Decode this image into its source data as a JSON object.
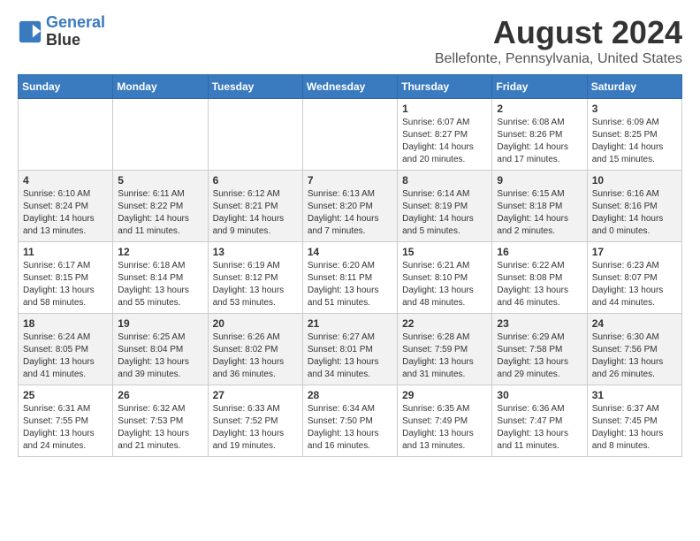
{
  "header": {
    "logo_line1": "General",
    "logo_line2": "Blue",
    "main_title": "August 2024",
    "subtitle": "Bellefonte, Pennsylvania, United States"
  },
  "days_of_week": [
    "Sunday",
    "Monday",
    "Tuesday",
    "Wednesday",
    "Thursday",
    "Friday",
    "Saturday"
  ],
  "weeks": [
    [
      {
        "day": "",
        "info": ""
      },
      {
        "day": "",
        "info": ""
      },
      {
        "day": "",
        "info": ""
      },
      {
        "day": "",
        "info": ""
      },
      {
        "day": "1",
        "info": "Sunrise: 6:07 AM\nSunset: 8:27 PM\nDaylight: 14 hours\nand 20 minutes."
      },
      {
        "day": "2",
        "info": "Sunrise: 6:08 AM\nSunset: 8:26 PM\nDaylight: 14 hours\nand 17 minutes."
      },
      {
        "day": "3",
        "info": "Sunrise: 6:09 AM\nSunset: 8:25 PM\nDaylight: 14 hours\nand 15 minutes."
      }
    ],
    [
      {
        "day": "4",
        "info": "Sunrise: 6:10 AM\nSunset: 8:24 PM\nDaylight: 14 hours\nand 13 minutes."
      },
      {
        "day": "5",
        "info": "Sunrise: 6:11 AM\nSunset: 8:22 PM\nDaylight: 14 hours\nand 11 minutes."
      },
      {
        "day": "6",
        "info": "Sunrise: 6:12 AM\nSunset: 8:21 PM\nDaylight: 14 hours\nand 9 minutes."
      },
      {
        "day": "7",
        "info": "Sunrise: 6:13 AM\nSunset: 8:20 PM\nDaylight: 14 hours\nand 7 minutes."
      },
      {
        "day": "8",
        "info": "Sunrise: 6:14 AM\nSunset: 8:19 PM\nDaylight: 14 hours\nand 5 minutes."
      },
      {
        "day": "9",
        "info": "Sunrise: 6:15 AM\nSunset: 8:18 PM\nDaylight: 14 hours\nand 2 minutes."
      },
      {
        "day": "10",
        "info": "Sunrise: 6:16 AM\nSunset: 8:16 PM\nDaylight: 14 hours\nand 0 minutes."
      }
    ],
    [
      {
        "day": "11",
        "info": "Sunrise: 6:17 AM\nSunset: 8:15 PM\nDaylight: 13 hours\nand 58 minutes."
      },
      {
        "day": "12",
        "info": "Sunrise: 6:18 AM\nSunset: 8:14 PM\nDaylight: 13 hours\nand 55 minutes."
      },
      {
        "day": "13",
        "info": "Sunrise: 6:19 AM\nSunset: 8:12 PM\nDaylight: 13 hours\nand 53 minutes."
      },
      {
        "day": "14",
        "info": "Sunrise: 6:20 AM\nSunset: 8:11 PM\nDaylight: 13 hours\nand 51 minutes."
      },
      {
        "day": "15",
        "info": "Sunrise: 6:21 AM\nSunset: 8:10 PM\nDaylight: 13 hours\nand 48 minutes."
      },
      {
        "day": "16",
        "info": "Sunrise: 6:22 AM\nSunset: 8:08 PM\nDaylight: 13 hours\nand 46 minutes."
      },
      {
        "day": "17",
        "info": "Sunrise: 6:23 AM\nSunset: 8:07 PM\nDaylight: 13 hours\nand 44 minutes."
      }
    ],
    [
      {
        "day": "18",
        "info": "Sunrise: 6:24 AM\nSunset: 8:05 PM\nDaylight: 13 hours\nand 41 minutes."
      },
      {
        "day": "19",
        "info": "Sunrise: 6:25 AM\nSunset: 8:04 PM\nDaylight: 13 hours\nand 39 minutes."
      },
      {
        "day": "20",
        "info": "Sunrise: 6:26 AM\nSunset: 8:02 PM\nDaylight: 13 hours\nand 36 minutes."
      },
      {
        "day": "21",
        "info": "Sunrise: 6:27 AM\nSunset: 8:01 PM\nDaylight: 13 hours\nand 34 minutes."
      },
      {
        "day": "22",
        "info": "Sunrise: 6:28 AM\nSunset: 7:59 PM\nDaylight: 13 hours\nand 31 minutes."
      },
      {
        "day": "23",
        "info": "Sunrise: 6:29 AM\nSunset: 7:58 PM\nDaylight: 13 hours\nand 29 minutes."
      },
      {
        "day": "24",
        "info": "Sunrise: 6:30 AM\nSunset: 7:56 PM\nDaylight: 13 hours\nand 26 minutes."
      }
    ],
    [
      {
        "day": "25",
        "info": "Sunrise: 6:31 AM\nSunset: 7:55 PM\nDaylight: 13 hours\nand 24 minutes."
      },
      {
        "day": "26",
        "info": "Sunrise: 6:32 AM\nSunset: 7:53 PM\nDaylight: 13 hours\nand 21 minutes."
      },
      {
        "day": "27",
        "info": "Sunrise: 6:33 AM\nSunset: 7:52 PM\nDaylight: 13 hours\nand 19 minutes."
      },
      {
        "day": "28",
        "info": "Sunrise: 6:34 AM\nSunset: 7:50 PM\nDaylight: 13 hours\nand 16 minutes."
      },
      {
        "day": "29",
        "info": "Sunrise: 6:35 AM\nSunset: 7:49 PM\nDaylight: 13 hours\nand 13 minutes."
      },
      {
        "day": "30",
        "info": "Sunrise: 6:36 AM\nSunset: 7:47 PM\nDaylight: 13 hours\nand 11 minutes."
      },
      {
        "day": "31",
        "info": "Sunrise: 6:37 AM\nSunset: 7:45 PM\nDaylight: 13 hours\nand 8 minutes."
      }
    ]
  ]
}
